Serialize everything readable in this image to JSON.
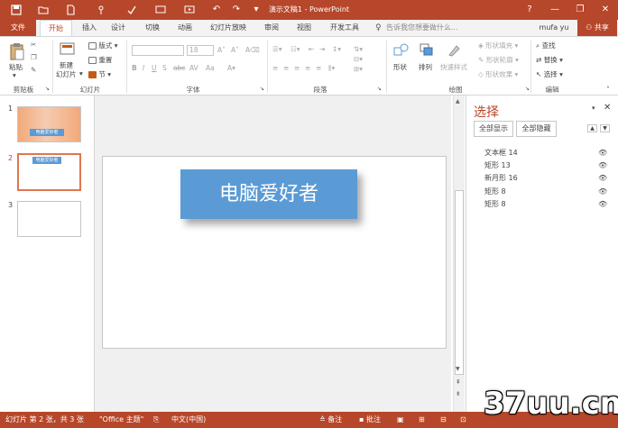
{
  "window": {
    "title": "演示文稿1 - PowerPoint",
    "help_icon": "?",
    "minimize_icon": "—",
    "restore_icon": "❐",
    "close_icon": "✕"
  },
  "tabs": {
    "file": "文件",
    "items": [
      "开始",
      "插入",
      "设计",
      "切换",
      "动画",
      "幻灯片放映",
      "审阅",
      "视图",
      "开发工具"
    ],
    "tell_me": "告诉我您想要做什么...",
    "user": "mufa yu",
    "share": "共享"
  },
  "ribbon": {
    "clipboard": {
      "label": "剪贴板",
      "paste": "粘贴"
    },
    "slides": {
      "label": "幻灯片",
      "new_slide_1": "新建",
      "new_slide_2": "幻灯片",
      "layout": "版式",
      "reset": "重置",
      "section": "节"
    },
    "font": {
      "label": "字体",
      "font_size": "18"
    },
    "paragraph": {
      "label": "段落"
    },
    "drawing": {
      "label": "绘图",
      "shapes": "形状",
      "arrange": "排列",
      "quick_styles": "快速样式",
      "fill": "形状填充",
      "outline": "形状轮廓",
      "effects": "形状效果"
    },
    "editing": {
      "label": "编辑",
      "find": "查找",
      "replace": "替换",
      "select": "选择"
    }
  },
  "thumbnails": [
    {
      "number": "1",
      "text": "电脑爱好者"
    },
    {
      "number": "2",
      "text": "电脑爱好者"
    },
    {
      "number": "3",
      "text": ""
    }
  ],
  "slide": {
    "text": "电脑爱好者"
  },
  "selection_pane": {
    "title": "选择",
    "show_all": "全部显示",
    "hide_all": "全部隐藏",
    "items": [
      "文本框 14",
      "矩形 13",
      "新月形 16",
      "矩形 8",
      "矩形 8"
    ]
  },
  "status": {
    "slide_info": "幻灯片 第 2 张，共 3 张",
    "theme": "\"Office 主题\"",
    "language": "中文(中国)",
    "notes": "备注",
    "comments": "批注"
  },
  "watermark": "37uu.cn",
  "colors": {
    "accent": "#b7472a",
    "shape_fill": "#5b9bd5"
  }
}
